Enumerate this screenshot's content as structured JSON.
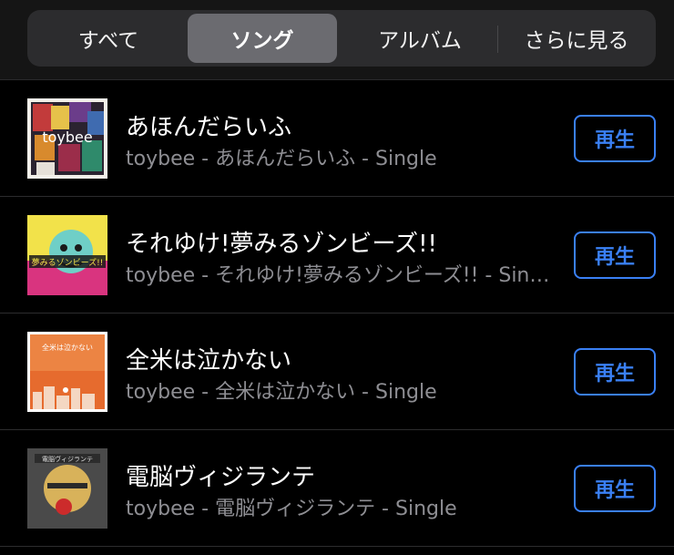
{
  "tabs": [
    {
      "label": "すべて",
      "selected": false
    },
    {
      "label": "ソング",
      "selected": true
    },
    {
      "label": "アルバム",
      "selected": false
    },
    {
      "label": "さらに見る",
      "selected": false
    }
  ],
  "songs": [
    {
      "title": "あほんだらいふ",
      "subtitle": "toybee - あほんだらいふ - Single",
      "play_label": "再生",
      "art_text": "toybee"
    },
    {
      "title": "それゆけ!夢みるゾンビーズ!!",
      "subtitle": "toybee - それゆけ!夢みるゾンビーズ!! - Single",
      "play_label": "再生",
      "art_text": "夢みるゾンビーズ!!"
    },
    {
      "title": "全米は泣かない",
      "subtitle": "toybee - 全米は泣かない - Single",
      "play_label": "再生",
      "art_text": "全米は泣かない"
    },
    {
      "title": "電脳ヴィジランテ",
      "subtitle": "toybee - 電脳ヴィジランテ - Single",
      "play_label": "再生",
      "art_text": "電脳ヴィジランテ"
    }
  ],
  "colors": {
    "accent": "#3a80f5",
    "background": "#000000",
    "secondary_text": "#8e8e93",
    "segment_selected": "#6b6b70"
  }
}
